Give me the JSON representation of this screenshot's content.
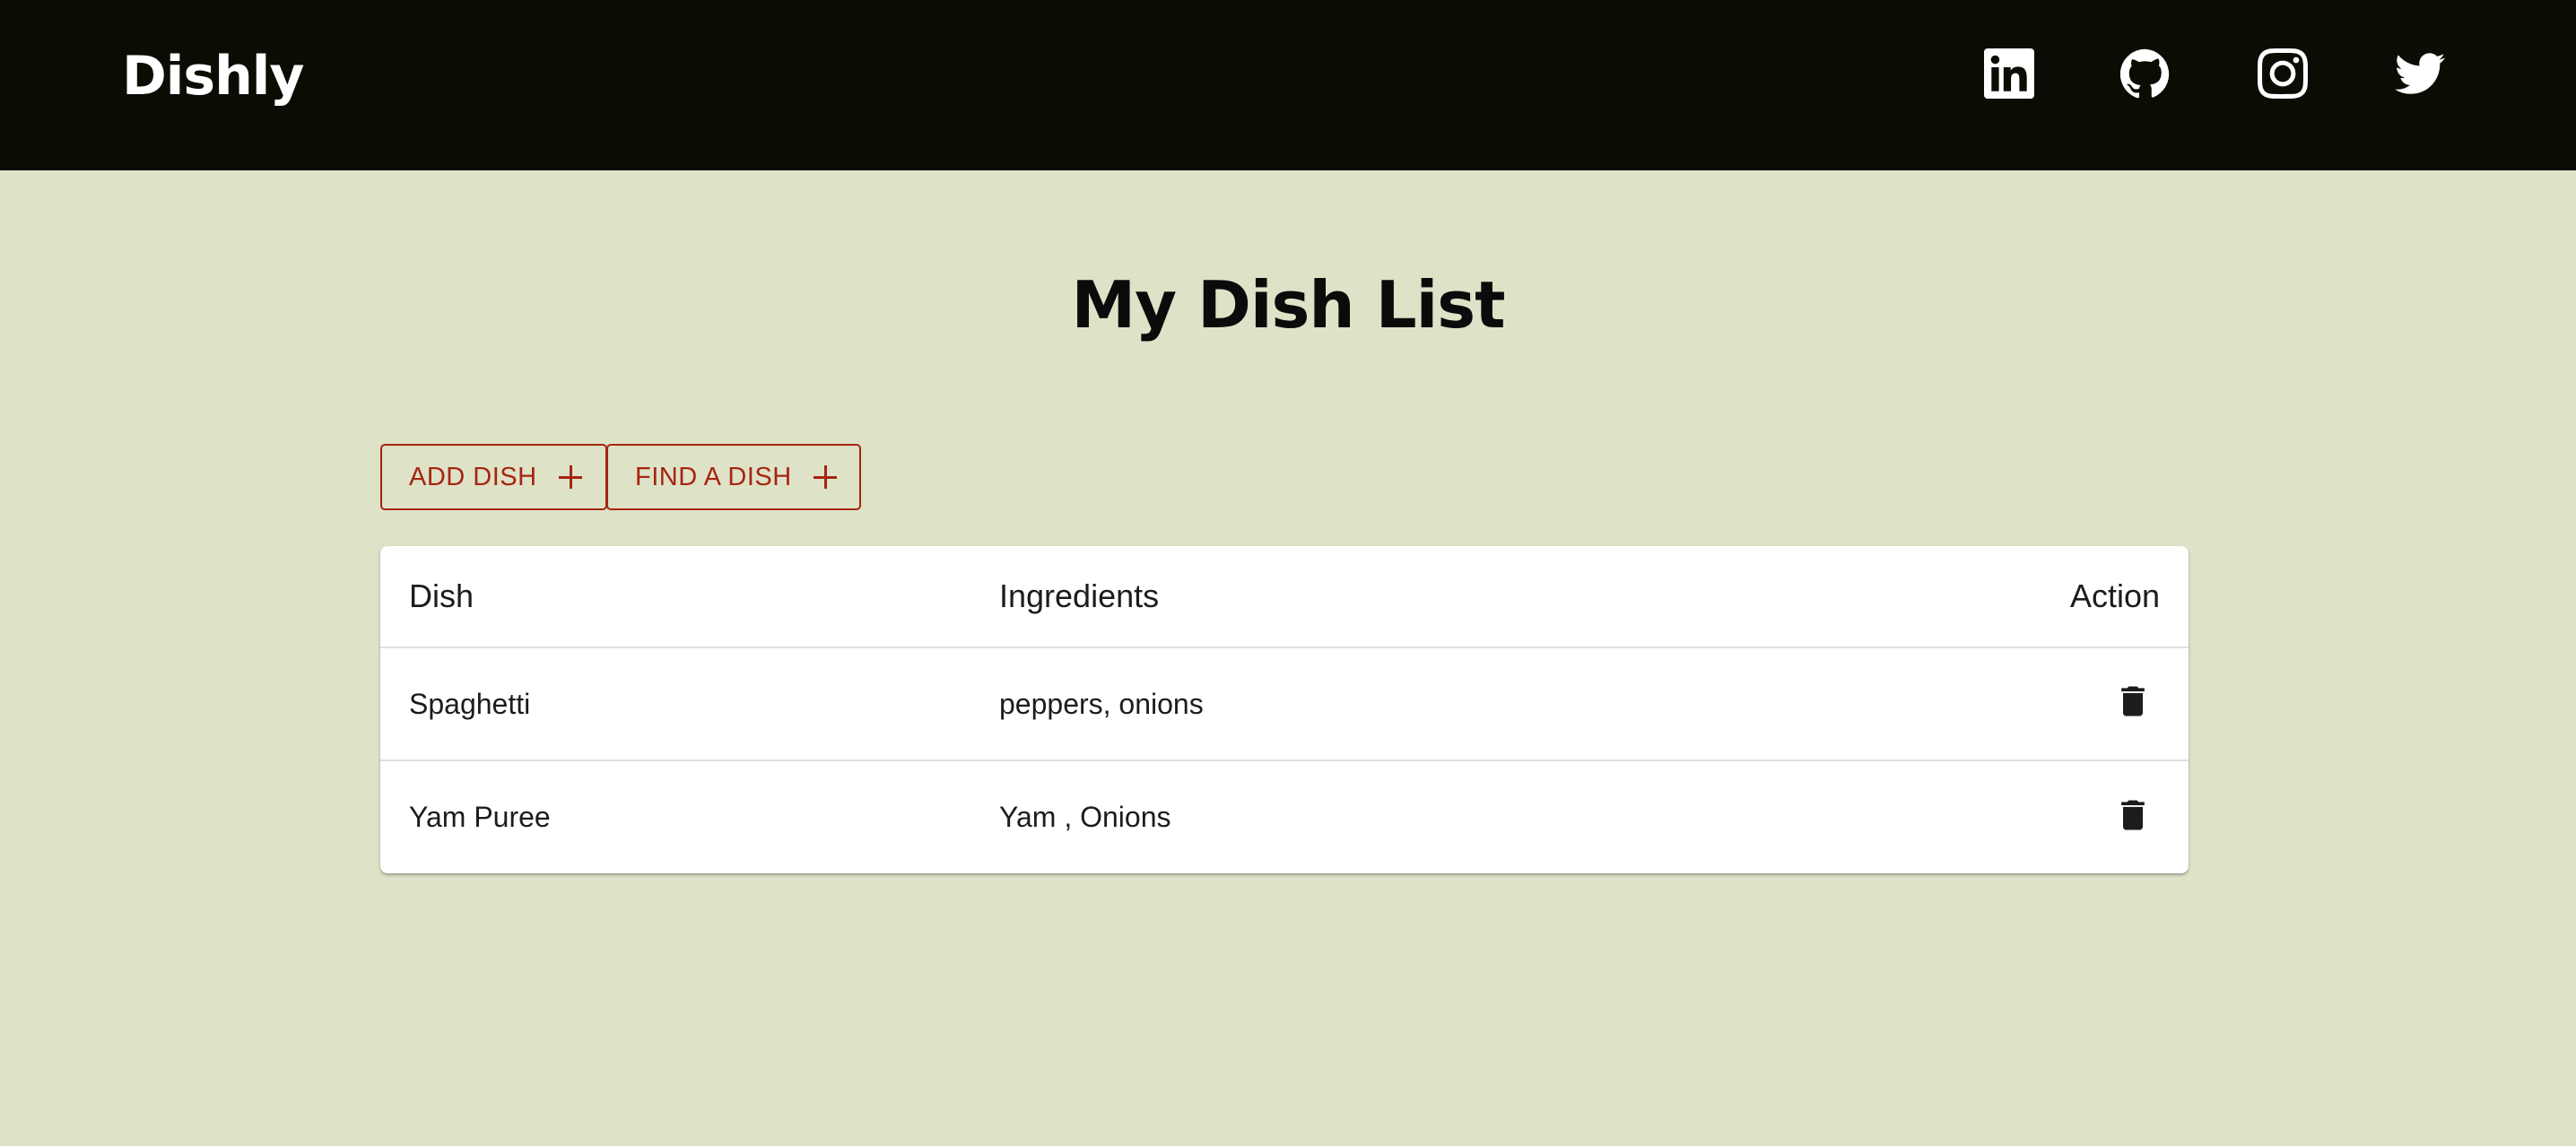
{
  "header": {
    "brand": "Dishly",
    "social": [
      {
        "icon": "linkedin-icon"
      },
      {
        "icon": "github-icon"
      },
      {
        "icon": "instagram-icon"
      },
      {
        "icon": "twitter-icon"
      }
    ]
  },
  "main": {
    "title": "My Dish List",
    "buttons": {
      "add": "ADD DISH",
      "find": "FIND A DISH"
    },
    "table": {
      "columns": [
        "Dish",
        "Ingredients",
        "Action"
      ],
      "rows": [
        {
          "dish": "Spaghetti",
          "ingredients": "peppers, onions",
          "action_icon": "trash-icon"
        },
        {
          "dish": "Yam Puree",
          "ingredients": "Yam , Onions",
          "action_icon": "trash-icon"
        }
      ]
    }
  },
  "colors": {
    "header_bg": "#0b0c04",
    "page_bg": "#dee2c7",
    "accent": "#a52512"
  }
}
